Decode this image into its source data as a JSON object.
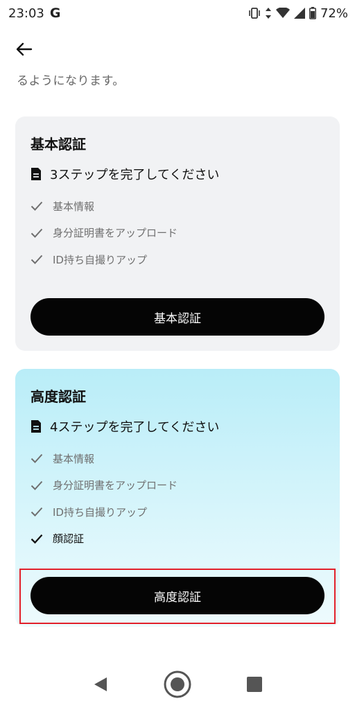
{
  "status_bar": {
    "time": "23:03",
    "google_badge": "G",
    "battery": "72%"
  },
  "intro_text": "るようになります。",
  "basic_card": {
    "title": "基本認証",
    "steps_text": "3ステップを完了してください",
    "items": [
      {
        "label": "基本情報"
      },
      {
        "label": "身分証明書をアップロード"
      },
      {
        "label": "ID持ち自撮りアップ"
      }
    ],
    "button_label": "基本認証"
  },
  "advanced_card": {
    "title": "高度認証",
    "steps_text": "4ステップを完了してください",
    "items": [
      {
        "label": "基本情報"
      },
      {
        "label": "身分証明書をアップロード"
      },
      {
        "label": "ID持ち自撮りアップ"
      },
      {
        "label": "顔認証"
      }
    ],
    "button_label": "高度認証"
  },
  "icons": {
    "back": "arrow-left-icon",
    "document": "document-icon",
    "check": "check-icon",
    "nav_back": "triangle-back-icon",
    "nav_home": "circle-home-icon",
    "nav_recents": "square-recents-icon"
  },
  "colors": {
    "basic_card_bg": "#f1f2f4",
    "advanced_card_bg": "#b9edf8",
    "button_bg": "#050505",
    "highlight_border": "#e2202a"
  }
}
